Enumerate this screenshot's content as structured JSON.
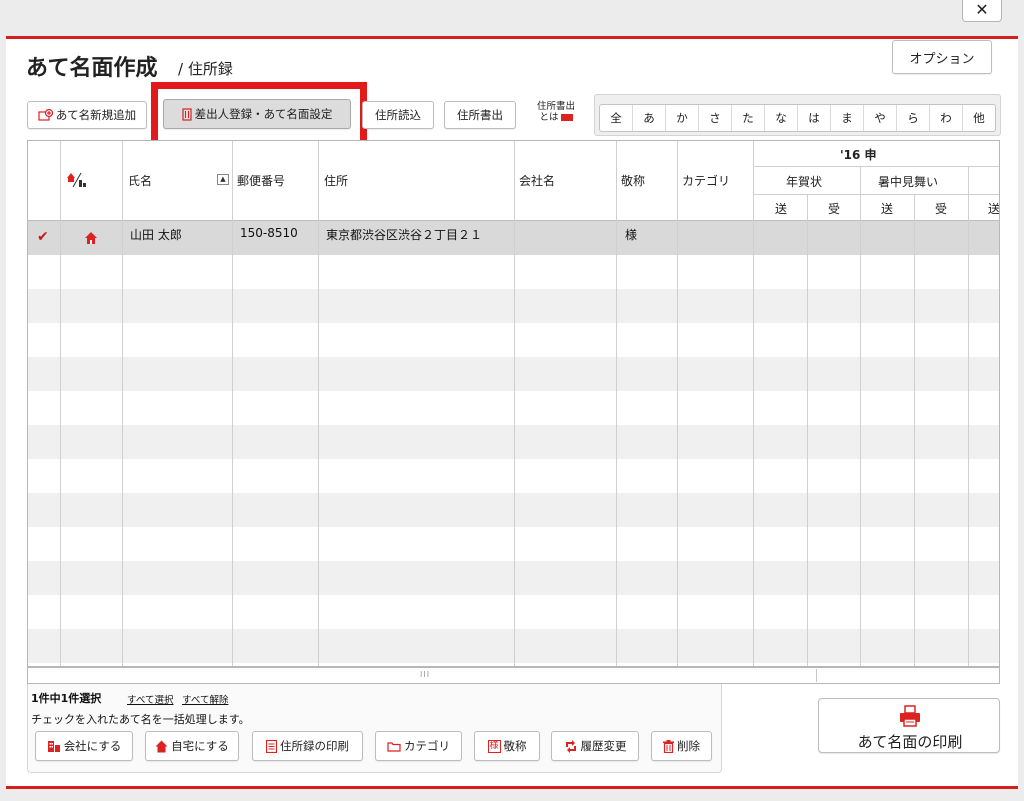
{
  "window": {
    "close_glyph": "✕"
  },
  "header": {
    "title": "あて名面作成",
    "subtitle": "/ 住所録",
    "option_label": "オプション"
  },
  "toolbar": {
    "add_label": "あて名新規追加",
    "sender_label": "差出人登録・あて名面設定",
    "import_label": "住所読込",
    "export_label": "住所書出",
    "what_export_line1": "住所書出",
    "what_export_line2": "とは"
  },
  "kana_filter": [
    "全",
    "あ",
    "か",
    "さ",
    "た",
    "な",
    "は",
    "ま",
    "や",
    "ら",
    "わ",
    "他"
  ],
  "table": {
    "headers": {
      "name": "氏名",
      "postal": "郵便番号",
      "address": "住所",
      "company": "会社名",
      "honorific": "敬称",
      "category": "カテゴリ",
      "year": "'16 申",
      "nenga": "年賀状",
      "shochu": "暑中見舞い",
      "sent": "送",
      "received": "受",
      "sent2": "送",
      "received2": "受",
      "sent3": "送"
    },
    "rows": [
      {
        "checked": "✔",
        "name": "山田 太郎",
        "postal": "150-8510",
        "address": "東京都渋谷区渋谷２丁目２１",
        "company": "",
        "honorific": "様",
        "category": ""
      }
    ],
    "scroll_grip": "III"
  },
  "footer": {
    "selection_text": "1件中1件選択",
    "select_all": "すべて選択",
    "deselect_all": "すべて解除",
    "bulk_desc": "チェックを入れたあて名を一括処理します。",
    "buttons": {
      "company": "会社にする",
      "home": "自宅にする",
      "print_list": "住所録の印刷",
      "category": "カテゴリ",
      "honorific": "敬称",
      "history": "履歴変更",
      "delete": "削除"
    },
    "honorific_icon_char": "様",
    "print_label": "あて名面の印刷"
  },
  "colors": {
    "accent": "#d52020",
    "highlight": "#e21a1a"
  }
}
